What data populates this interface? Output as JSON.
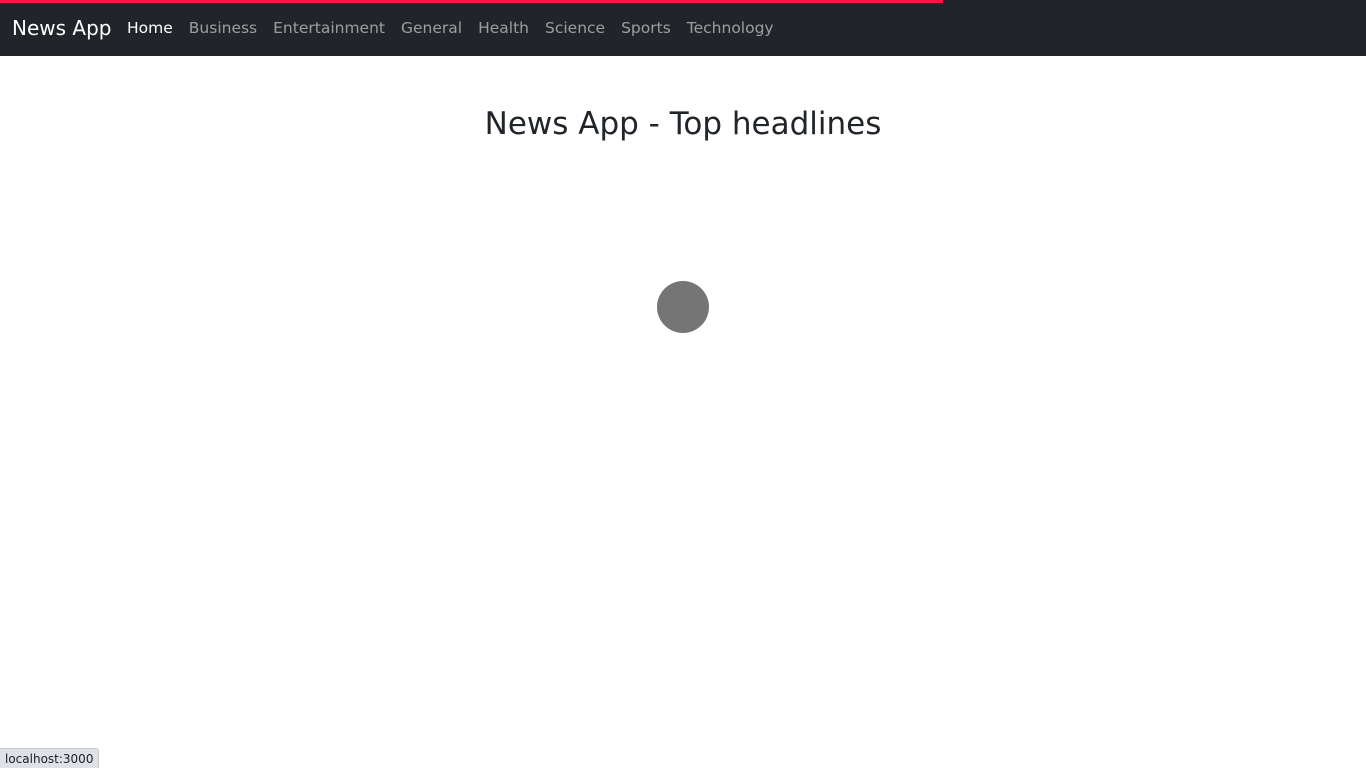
{
  "loading_bar": {
    "progress": 0.69,
    "color": "#f11946"
  },
  "navbar": {
    "brand": "News App",
    "links": [
      {
        "label": "Home",
        "active": true
      },
      {
        "label": "Business",
        "active": false
      },
      {
        "label": "Entertainment",
        "active": false
      },
      {
        "label": "General",
        "active": false
      },
      {
        "label": "Health",
        "active": false
      },
      {
        "label": "Science",
        "active": false
      },
      {
        "label": "Sports",
        "active": false
      },
      {
        "label": "Technology",
        "active": false
      }
    ]
  },
  "main": {
    "title": "News App - Top headlines",
    "spinner_icon": "loading-spinner-icon"
  },
  "status_bar": {
    "url": "localhost:3000"
  },
  "colors": {
    "navbar_bg": "#212529",
    "accent": "#f11946",
    "spinner": "#757575"
  }
}
